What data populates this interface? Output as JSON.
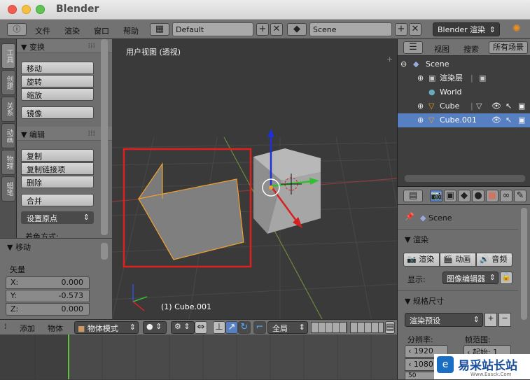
{
  "app": {
    "title": "Blender"
  },
  "menu": {
    "file": "文件",
    "render": "渲染",
    "window": "窗口",
    "help": "帮助"
  },
  "info": {
    "layout": "Default",
    "scene": "Scene",
    "engine": "Blender 渲染"
  },
  "tabs": [
    "工具",
    "创建",
    "关系",
    "动画",
    "物理",
    "蜡笔"
  ],
  "transform": {
    "title": "变换",
    "move": "移动",
    "rotate": "旋转",
    "scale": "缩放",
    "mirror": "镜像"
  },
  "edit": {
    "title": "编辑",
    "duplicate": "复制",
    "duplicate_linked": "复制链接项",
    "delete": "删除",
    "join": "合并",
    "set_origin": "设置原点",
    "shading": "着色方式:"
  },
  "operator": {
    "title": "移动",
    "vector": "矢量",
    "x_label": "X:",
    "x_value": "0.000",
    "y_label": "Y:",
    "y_value": "-0.573",
    "z_label": "Z:",
    "z_value": "0.000"
  },
  "viewport": {
    "label": "用户视图 (透视)",
    "object_label": "(1) Cube.001",
    "highlight_color": "#e0201c"
  },
  "outliner": {
    "view": "视图",
    "search": "搜索",
    "all_scenes": "所有场景",
    "rows": [
      {
        "label": "Scene"
      },
      {
        "label": "渲染层"
      },
      {
        "label": "World"
      },
      {
        "label": "Cube"
      },
      {
        "label": "Cube.001"
      }
    ]
  },
  "props": {
    "scene": "Scene",
    "render_title": "渲染",
    "render_btn": "渲染",
    "anim_btn": "动画",
    "audio_btn": "音频",
    "display": "显示:",
    "display_value": "图像编辑器",
    "dims_title": "规格尺寸",
    "preset": "渲染预设",
    "resolution": "分辨率:",
    "frame_range": "帧范围:",
    "res_x": "1920 px",
    "res_y": "1080",
    "res_pct": "50",
    "start": "起始:",
    "start_value": "1"
  },
  "vheader": {
    "add": "添加",
    "object": "物体",
    "mode": "物体模式",
    "global": "全局"
  },
  "watermark": {
    "text": "易采站长站",
    "sub": "Www.Easck.Com"
  },
  "colors": {
    "accent": "#5680c2",
    "selected_orange": "#f0a030",
    "playhead": "#60c040"
  }
}
